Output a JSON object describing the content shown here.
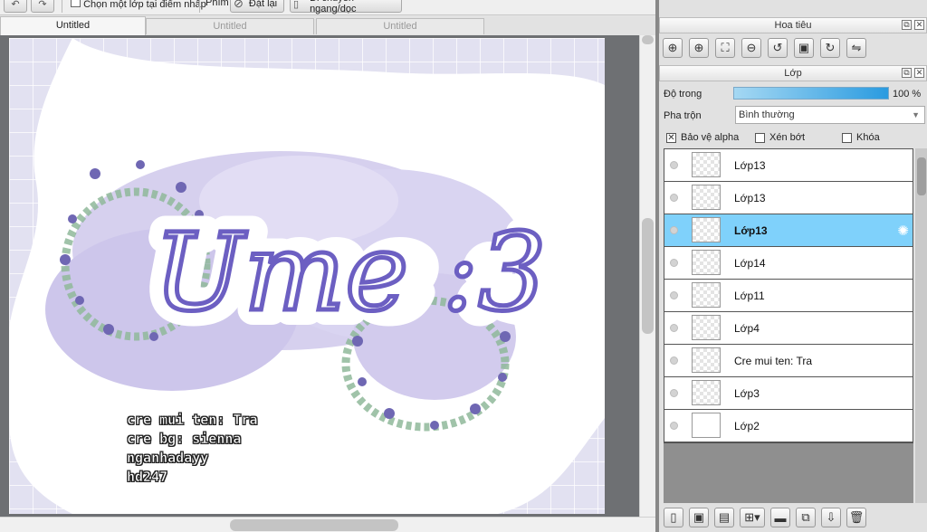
{
  "toolbar": {
    "pick_layer_label": "Chọn một lớp tại điểm nhấp",
    "keys_label": "Phím",
    "reset_label": "Đặt lại",
    "move_label": "Di chuyển ngang/dọc"
  },
  "tabs": [
    {
      "label": "Untitled",
      "active": true
    },
    {
      "label": "Untitled",
      "active": false
    },
    {
      "label": "Untitled",
      "active": false
    }
  ],
  "artwork": {
    "title": "Ume :3",
    "credits": [
      "cre mui ten: Tra",
      "cre bg: sienna",
      "nganhadayy",
      "hd247"
    ]
  },
  "navigator": {
    "title": "Hoa tiêu",
    "tools": [
      "zoom-fit-icon",
      "zoom-in-icon",
      "fit-screen-icon",
      "zoom-out-icon",
      "rotate-left-icon",
      "actual-size-icon",
      "rotate-right-icon",
      "flip-icon"
    ]
  },
  "layers_panel": {
    "title": "Lớp",
    "opacity_label": "Độ trong",
    "opacity_value": "100 %",
    "blend_label": "Pha trộn",
    "blend_value": "Bình thường",
    "protect_alpha_label": "Bảo vệ alpha",
    "protect_alpha_checked": true,
    "clipping_label": "Xén bớt",
    "clipping_checked": false,
    "lock_label": "Khóa",
    "lock_checked": false,
    "layers": [
      {
        "name": "Lớp13",
        "selected": false,
        "thumb": "transparent"
      },
      {
        "name": "Lớp13",
        "selected": false,
        "thumb": "transparent"
      },
      {
        "name": "Lớp13",
        "selected": true,
        "thumb": "transparent"
      },
      {
        "name": "Lớp14",
        "selected": false,
        "thumb": "transparent"
      },
      {
        "name": "Lớp11",
        "selected": false,
        "thumb": "transparent"
      },
      {
        "name": "Lớp4",
        "selected": false,
        "thumb": "transparent"
      },
      {
        "name": "Cre mui ten: Tra",
        "selected": false,
        "thumb": "transparent"
      },
      {
        "name": "Lớp3",
        "selected": false,
        "thumb": "transparent"
      },
      {
        "name": "Lớp2",
        "selected": false,
        "thumb": "white"
      }
    ],
    "tools": [
      "new-layer-icon",
      "new-raster-layer-icon",
      "duplicate-layer-icon",
      "add-layer-menu-icon",
      "folder-icon",
      "copy-layer-icon",
      "merge-down-icon",
      "delete-layer-icon"
    ]
  },
  "colors": {
    "accent_selected": "#7fd1fb",
    "canvas_bg": "#e2e1f1",
    "lettering": "#6c5fc2"
  }
}
